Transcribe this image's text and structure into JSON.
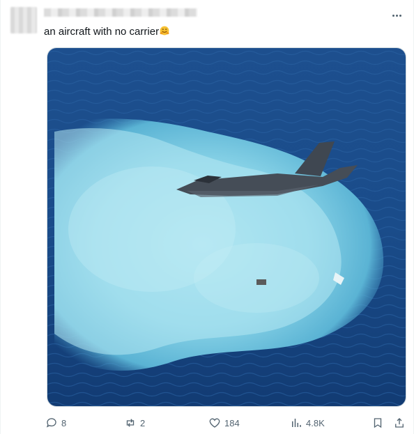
{
  "post": {
    "text": "an aircraft with no carrier",
    "emoji_icon": "hugging-face-emoji"
  },
  "actions": {
    "replies": "8",
    "reposts": "2",
    "likes": "184",
    "views": "4.8K"
  },
  "colors": {
    "icon_gray": "#536471",
    "ocean_dark": "#163f7a",
    "foam": "#8fd3e6"
  }
}
